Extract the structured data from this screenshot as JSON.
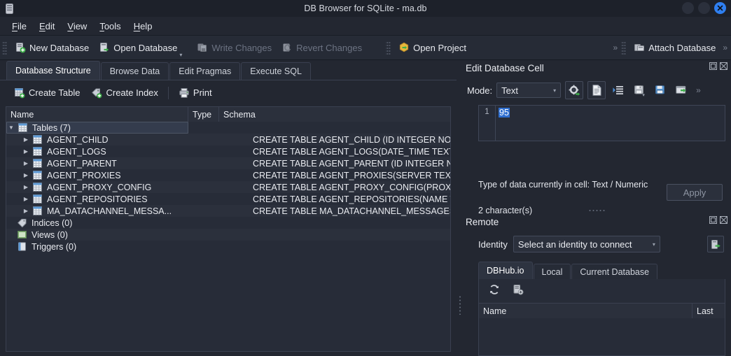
{
  "window": {
    "title": "DB Browser for SQLite - ma.db",
    "app_icon": "database-icon",
    "minimize_label": "",
    "maximize_label": "",
    "close_label": "✕"
  },
  "menubar": {
    "items": [
      {
        "label": "File",
        "mnemonic": "F"
      },
      {
        "label": "Edit",
        "mnemonic": "E"
      },
      {
        "label": "View",
        "mnemonic": "V"
      },
      {
        "label": "Tools",
        "mnemonic": "T"
      },
      {
        "label": "Help",
        "mnemonic": "H"
      }
    ]
  },
  "toolbar": {
    "new_database": "New Database",
    "open_database": "Open Database",
    "write_changes": "Write Changes",
    "revert_changes": "Revert Changes",
    "open_project": "Open Project",
    "attach_database": "Attach Database",
    "overflow_chevron": "»",
    "dropdown_caret": "▾"
  },
  "main_tabs": [
    {
      "label": "Database Structure",
      "active": true
    },
    {
      "label": "Browse Data",
      "active": false
    },
    {
      "label": "Edit Pragmas",
      "active": false
    },
    {
      "label": "Execute SQL",
      "active": false
    }
  ],
  "structure_toolbar": {
    "create_table": "Create Table",
    "create_index": "Create Index",
    "print": "Print"
  },
  "tree": {
    "columns": [
      "Name",
      "Type",
      "Schema"
    ],
    "rows": [
      {
        "name": "Tables (7)",
        "depth": 0,
        "icon": "table-group-icon",
        "twisty": "expanded",
        "type": "",
        "schema": "",
        "selected": true
      },
      {
        "name": "AGENT_CHILD",
        "depth": 1,
        "icon": "table-icon",
        "twisty": "collapsed",
        "type": "",
        "schema": "CREATE TABLE AGENT_CHILD (ID INTEGER NOT NULL, NA",
        "selected": false
      },
      {
        "name": "AGENT_LOGS",
        "depth": 1,
        "icon": "table-icon",
        "twisty": "collapsed",
        "type": "",
        "schema": "CREATE TABLE AGENT_LOGS(DATE_TIME TEXT NOT NULL",
        "selected": false
      },
      {
        "name": "AGENT_PARENT",
        "depth": 1,
        "icon": "table-icon",
        "twisty": "collapsed",
        "type": "",
        "schema": "CREATE TABLE AGENT_PARENT (ID INTEGER NOT NULL U",
        "selected": false
      },
      {
        "name": "AGENT_PROXIES",
        "depth": 1,
        "icon": "table-icon",
        "twisty": "collapsed",
        "type": "",
        "schema": "CREATE TABLE AGENT_PROXIES(SERVER TEXT, PORT INT",
        "selected": false
      },
      {
        "name": "AGENT_PROXY_CONFIG",
        "depth": 1,
        "icon": "table-icon",
        "twisty": "collapsed",
        "type": "",
        "schema": "CREATE TABLE AGENT_PROXY_CONFIG(PROXY_USAGE I",
        "selected": false
      },
      {
        "name": "AGENT_REPOSITORIES",
        "depth": 1,
        "icon": "table-icon",
        "twisty": "collapsed",
        "type": "",
        "schema": "CREATE TABLE AGENT_REPOSITORIES(NAME TEXT NOT N",
        "selected": false
      },
      {
        "name": "MA_DATACHANNEL_MESSA...",
        "depth": 1,
        "icon": "table-icon",
        "twisty": "collapsed",
        "type": "",
        "schema": "CREATE TABLE MA_DATACHANNEL_MESSAGES (AUTO_ID",
        "selected": false
      },
      {
        "name": "Indices (0)",
        "depth": 0,
        "icon": "index-icon",
        "twisty": "none",
        "type": "",
        "schema": "",
        "selected": false
      },
      {
        "name": "Views (0)",
        "depth": 0,
        "icon": "view-icon",
        "twisty": "none",
        "type": "",
        "schema": "",
        "selected": false
      },
      {
        "name": "Triggers (0)",
        "depth": 0,
        "icon": "trigger-icon",
        "twisty": "none",
        "type": "",
        "schema": "",
        "selected": false
      }
    ]
  },
  "edit_cell": {
    "title": "Edit Database Cell",
    "mode_label": "Mode:",
    "mode_value": "Text",
    "mode_caret": "▾",
    "buttons": [
      {
        "name": "apply-data-icon"
      },
      {
        "name": "text-mode-icon"
      },
      {
        "name": "word-wrap-icon"
      },
      {
        "name": "import-icon"
      },
      {
        "name": "export-icon"
      },
      {
        "name": "open-in-external-icon"
      }
    ],
    "overflow_chevron": "»",
    "line_number": "1",
    "cell_value": "95",
    "type_info": "Type of data currently in cell: Text / Numeric",
    "char_info": "2 character(s)",
    "apply_label": "Apply",
    "dock_float_icon": "restore-icon",
    "dock_close_icon": "close-icon"
  },
  "remote": {
    "title": "Remote",
    "identity_label": "Identity",
    "identity_value": "Select an identity to connect",
    "identity_caret": "▾",
    "connect_icon": "connect-database-icon",
    "tabs": [
      {
        "label": "DBHub.io",
        "active": true
      },
      {
        "label": "Local",
        "active": false
      },
      {
        "label": "Current Database",
        "active": false
      }
    ],
    "refresh_icon": "refresh-icon",
    "add_icon": "add-database-icon",
    "columns": [
      "Name",
      "Last"
    ],
    "rows": [],
    "dock_float_icon": "restore-icon",
    "dock_close_icon": "close-icon"
  },
  "colors": {
    "window_bg": "#232731",
    "titlebar_bg": "#1d212a",
    "panel_bg": "#272c38",
    "accent_blue": "#2f7ff0",
    "selection_blue": "#2f6fd0",
    "text": "#e9ebf0",
    "disabled_text": "#6c7382",
    "border": "#3a4050"
  }
}
